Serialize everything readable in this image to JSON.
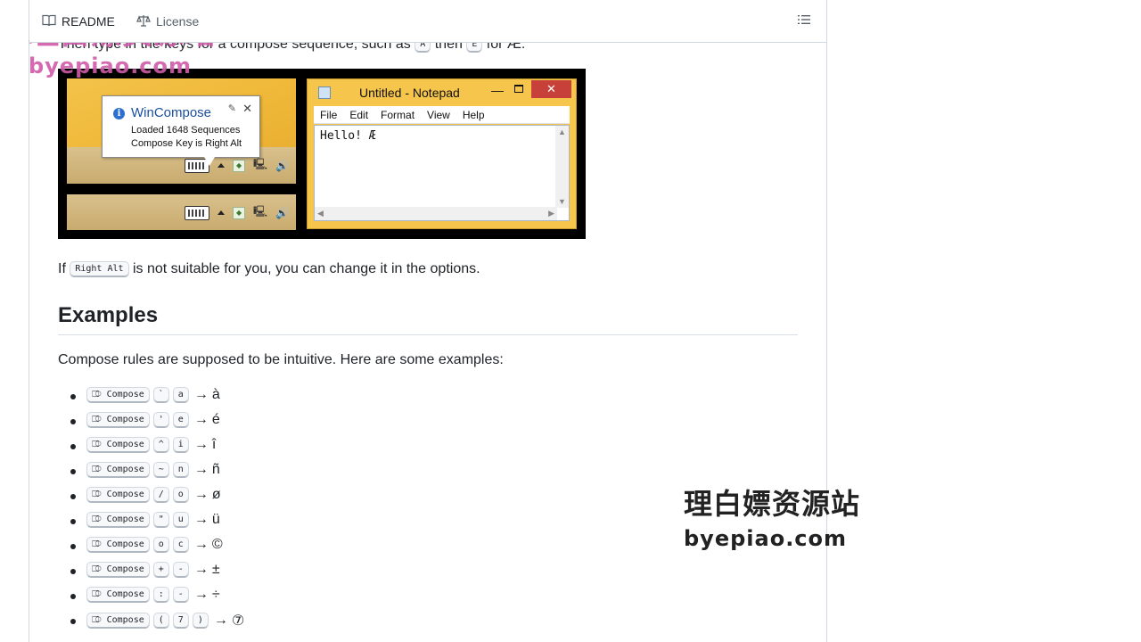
{
  "tabs": {
    "readme": "README",
    "license": "License"
  },
  "intro": {
    "prefix": "Then type in the keys for a compose sequence, such as",
    "key1": "A",
    "mid": "then",
    "key2": "E",
    "suffix": "for Æ:"
  },
  "screenshot": {
    "popup": {
      "title": "WinCompose",
      "line1": "Loaded 1648 Sequences",
      "line2": "Compose Key is Right Alt"
    },
    "notepad": {
      "title": "Untitled - Notepad",
      "menus": [
        "File",
        "Edit",
        "Format",
        "View",
        "Help"
      ],
      "text": "Hello! Æ"
    }
  },
  "options_line": {
    "prefix": "If",
    "key": "Right Alt",
    "suffix": "is not suitable for you, you can change it in the options."
  },
  "examples": {
    "heading": "Examples",
    "intro": "Compose rules are supposed to be intuitive. Here are some examples:",
    "compose_label": "⎄ Compose",
    "items": [
      {
        "keys": [
          "`",
          "a"
        ],
        "result": "à"
      },
      {
        "keys": [
          "'",
          "e"
        ],
        "result": "é"
      },
      {
        "keys": [
          "^",
          "i"
        ],
        "result": "î"
      },
      {
        "keys": [
          "~",
          "n"
        ],
        "result": "ñ"
      },
      {
        "keys": [
          "/",
          "o"
        ],
        "result": "ø"
      },
      {
        "keys": [
          "\"",
          "u"
        ],
        "result": "ü"
      },
      {
        "keys": [
          "o",
          "c"
        ],
        "result": "©"
      },
      {
        "keys": [
          "+",
          "-"
        ],
        "result": "±"
      },
      {
        "keys": [
          ":",
          "-"
        ],
        "result": "÷"
      },
      {
        "keys": [
          "(",
          "7",
          ")"
        ],
        "result": "⑦"
      }
    ]
  },
  "watermarks": {
    "top_line1": "理白嫖资源站",
    "top_line2": "byepiao.com",
    "mid_line1": "理白嫖资源站",
    "mid_line2": "byepiao.com"
  },
  "colors": {
    "accent_blue": "#1a4f9c",
    "watermark_pink": "#d05aa8",
    "watermark_dark": "#222222"
  }
}
